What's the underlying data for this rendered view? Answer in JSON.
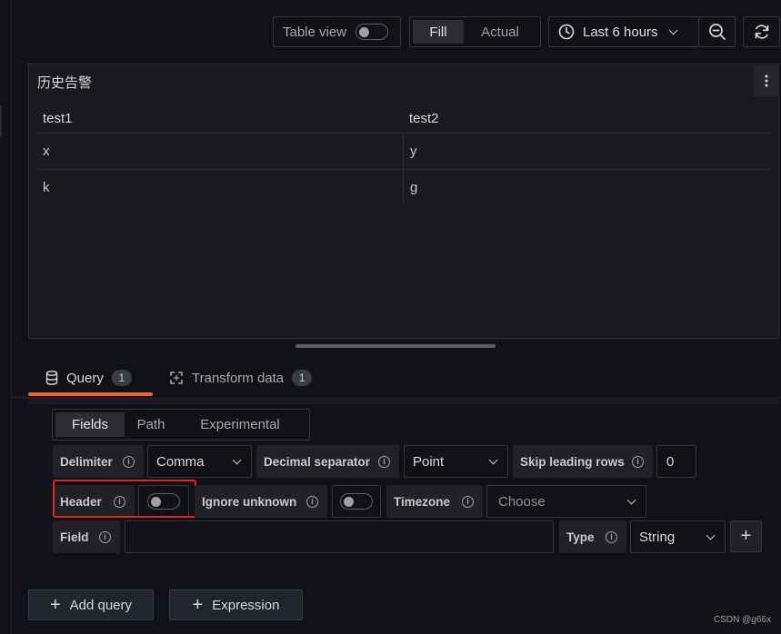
{
  "toolbar": {
    "table_view_label": "Table view",
    "fill_label": "Fill",
    "actual_label": "Actual",
    "time_range_label": "Last 6 hours"
  },
  "panel": {
    "title": "历史告警",
    "columns": [
      "test1",
      "test2"
    ],
    "rows": [
      [
        "x",
        "y"
      ],
      [
        "k",
        "g"
      ]
    ]
  },
  "tabs": {
    "query_label": "Query",
    "query_count": "1",
    "transform_label": "Transform data",
    "transform_count": "1"
  },
  "subtabs": {
    "fields": "Fields",
    "path": "Path",
    "experimental": "Experimental"
  },
  "form": {
    "delimiter_label": "Delimiter",
    "delimiter_value": "Comma",
    "decimal_separator_label": "Decimal separator",
    "decimal_separator_value": "Point",
    "skip_leading_rows_label": "Skip leading rows",
    "skip_leading_rows_value": "0",
    "header_label": "Header",
    "ignore_unknown_label": "Ignore unknown",
    "timezone_label": "Timezone",
    "timezone_placeholder": "Choose",
    "field_label": "Field",
    "field_value": "",
    "type_label": "Type",
    "type_value": "String"
  },
  "actions": {
    "add_query_label": "Add query",
    "expression_label": "Expression"
  },
  "watermark": "CSDN @g66x",
  "colors": {
    "accent": "#f2662c",
    "highlight_border": "#e0261f",
    "background": "#111217",
    "panel_background": "#181a1f"
  }
}
